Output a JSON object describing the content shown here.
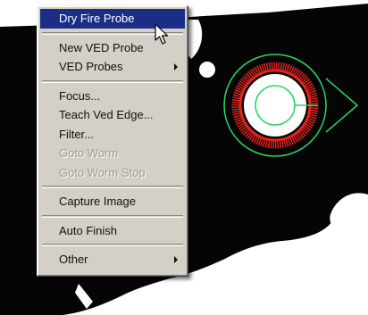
{
  "scene": {
    "background_color": "#050505",
    "cutout_color": "#ffffff",
    "inner_ring_color": "#2bd66a",
    "burst_color": "#e3231e"
  },
  "context_menu": {
    "items": [
      {
        "label": "Dry Fire Probe",
        "highlighted": true,
        "enabled": true,
        "submenu": false
      },
      {
        "separator": true
      },
      {
        "label": "New VED Probe",
        "enabled": true,
        "submenu": false
      },
      {
        "label": "VED Probes",
        "enabled": true,
        "submenu": true
      },
      {
        "separator": true
      },
      {
        "label": "Focus...",
        "enabled": true,
        "submenu": false
      },
      {
        "label": "Teach Ved Edge...",
        "enabled": true,
        "submenu": false
      },
      {
        "label": "Filter...",
        "enabled": true,
        "submenu": false
      },
      {
        "label": "Goto Worm",
        "enabled": false,
        "submenu": false
      },
      {
        "label": "Goto Worm Stop",
        "enabled": false,
        "submenu": false
      },
      {
        "separator": true
      },
      {
        "label": "Capture Image",
        "enabled": true,
        "submenu": false
      },
      {
        "separator": true
      },
      {
        "label": "Auto Finish",
        "enabled": true,
        "submenu": false
      },
      {
        "separator": true
      },
      {
        "label": "Other",
        "enabled": true,
        "submenu": true
      }
    ],
    "highlight_color": "#1b2e86"
  },
  "cursor": {
    "icon": "arrow-pointer-icon"
  }
}
